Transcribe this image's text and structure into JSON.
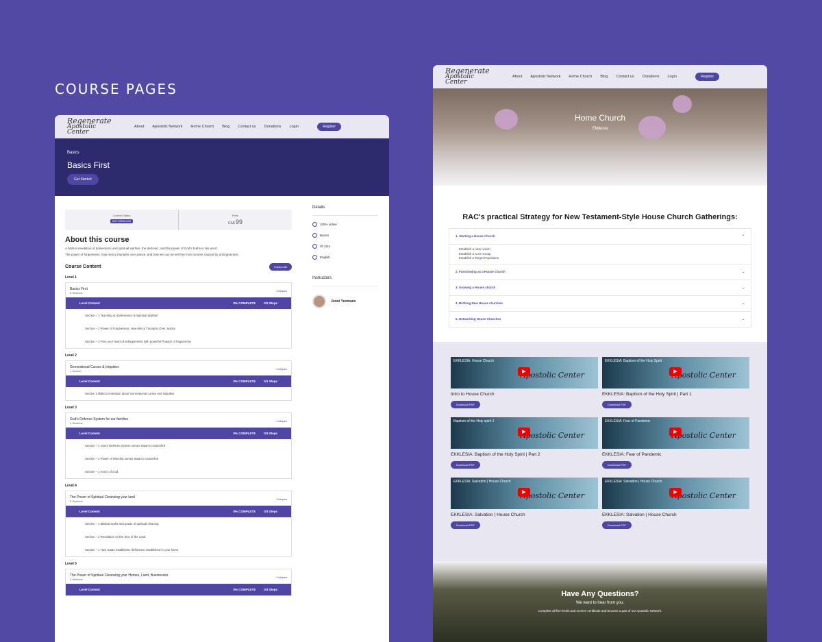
{
  "title": "COURSE PAGES",
  "nav": {
    "logo_top": "Regenerate",
    "logo_bottom": "Apostolic Center",
    "links": [
      "About",
      "Apostolic Network",
      "Home Church",
      "Blog",
      "Contact us",
      "Donations",
      "Login"
    ],
    "register": "Register"
  },
  "course": {
    "category": "Basics",
    "name": "Basics First",
    "cta": "Get Started",
    "status_label": "Current Status",
    "status_value": "NOT ENROLLED",
    "price_label": "Price",
    "price_currency": "CA$",
    "price": "99",
    "about_title": "About this course",
    "about_p1": "A biblical revelation of deliverance and spiritual warfare, the demonic, and the power of God's truths in His word.",
    "about_p2": "The power of forgiveness, how mercy triumphs over justice, and how we can be set free from torment caused by unforgiveness.",
    "content_title": "Course Content",
    "expand": "Expand All",
    "collapse": "Collapse",
    "level_content": "Level Content",
    "complete": "0% COMPLETE",
    "levels": [
      {
        "label": "Level 1",
        "title": "Basics First",
        "count": "3 Sections",
        "steps": "0/3 Steps",
        "sections": [
          "Section – 1 Teaching on Deliverance & Spiritual Warfare",
          "Section – 2 Power of Forgiveness, How Mercy Triumphs Over Justice",
          "Section – 3 Free your heart of unforgiveness with powerful Prayers of forgiveness"
        ]
      },
      {
        "label": "Level 2",
        "title": "Generational Curses & Iniquities",
        "count": "1 Section",
        "steps": "0/1 Steps",
        "sections": [
          "Section 1 Biblical revelation about Generational curses and iniquities"
        ]
      },
      {
        "label": "Level 3",
        "title": "God's Defence System for our families",
        "count": "3 Sections",
        "steps": "0/3 Steps",
        "sections": [
          "Section – 1 God's Defense System verses Satan's counterfeit",
          "Section – 2 Power of Worship verses Satan's counterfeit",
          "Section – 3 Armor of God"
        ]
      },
      {
        "label": "Level 4",
        "title": "The Power of Spiritual Cleansing your land",
        "count": "3 Sections",
        "steps": "0/3 Steps",
        "sections": [
          "Section – 1 Biblical truths and power of spiritual cleaning",
          "Section – 2 Revelation on the Sins of the Land",
          "Section – 1 How Satan establishes defilement established in your home"
        ]
      },
      {
        "label": "Level 5",
        "title": "The Power of Spiritual Cleansing your Homes, Land, Businesses",
        "count": "3 Sections",
        "steps": "0/3 Steps",
        "sections": []
      }
    ],
    "details_title": "Details",
    "details": [
      "100% online",
      "Basics",
      "3h 22m",
      "English"
    ],
    "instructors_title": "Instructors",
    "instructor": "Jonni Yeomans"
  },
  "homechurch": {
    "title": "Home Church",
    "subtitle": "Ekklesia",
    "strategy_title": "RAC's practical Strategy for New Testament-Style House Church Gatherings:",
    "accordion": [
      "1. Starting a House Church",
      "2. Functioning as a House Church",
      "3. Growing a House church",
      "4. Birthing New House churches",
      "5. Networking House Churches"
    ],
    "bullets": [
      "Establish a clear vision",
      "Establish a Core Group",
      "Establish a Target Population"
    ],
    "videos": [
      {
        "thumb": "EKKLESIA: House Church",
        "title": "Intro to House Church"
      },
      {
        "thumb": "EKKLESIA: Baptism of the Holy Spirit",
        "title": "EKKLESIA: Baptism of the Holy Spirit | Part 1"
      },
      {
        "thumb": "Baptism of the Holy spirit 2",
        "title": "EKKLESIA: Baptism of the Holy Spirit | Part 2"
      },
      {
        "thumb": "EKKLESIA: Fear of Pandemic",
        "title": "EKKLESIA: Fear of Pandemic"
      },
      {
        "thumb": "EKKLESIA: Salvation | House Church",
        "title": "EKKLESIA: Salvation | House Church"
      },
      {
        "thumb": "EKKLESIA: Salvation | House Church",
        "title": "EKKLESIA: Salvation | House Church"
      }
    ],
    "download": "Download PDF",
    "brand": "Apostolic Center",
    "q_title": "Have Any Questions?",
    "q_sub": "We want to hear from you.",
    "q_text": "Complete all five levels and receive certificate and become a part of our Apostolic Network."
  }
}
